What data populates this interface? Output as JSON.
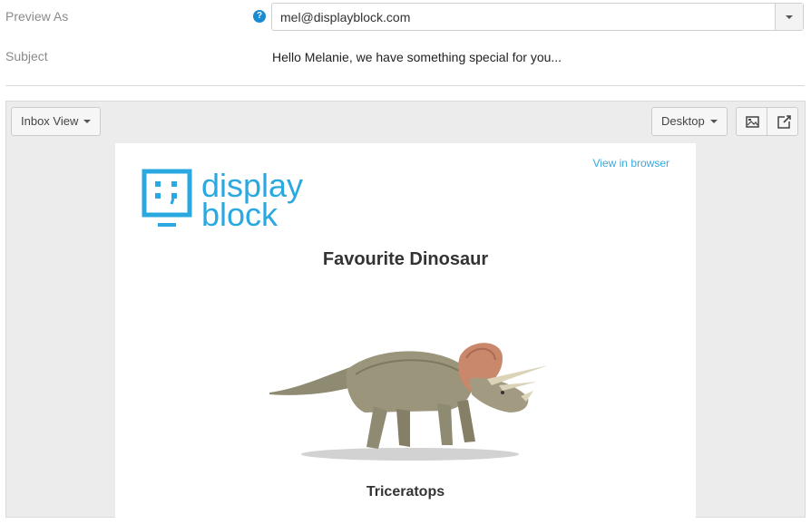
{
  "form": {
    "preview_as_label": "Preview As",
    "help_icon": "question-icon",
    "preview_as_value": "mel@displayblock.com",
    "subject_label": "Subject",
    "subject_value": "Hello Melanie, we have something special for you..."
  },
  "toolbar": {
    "view_select_label": "Inbox View",
    "device_select_label": "Desktop",
    "image_toggle_icon": "image-icon",
    "open_external_icon": "external-link-icon"
  },
  "email": {
    "view_in_browser": "View in browser",
    "logo_line1": "display",
    "logo_line2": "block",
    "title": "Favourite Dinosaur",
    "image_subject": "triceratops",
    "caption": "Triceratops"
  },
  "colors": {
    "brand": "#2aa8e0",
    "help_icon": "#1a8ad1",
    "link": "#3aa7d9"
  }
}
